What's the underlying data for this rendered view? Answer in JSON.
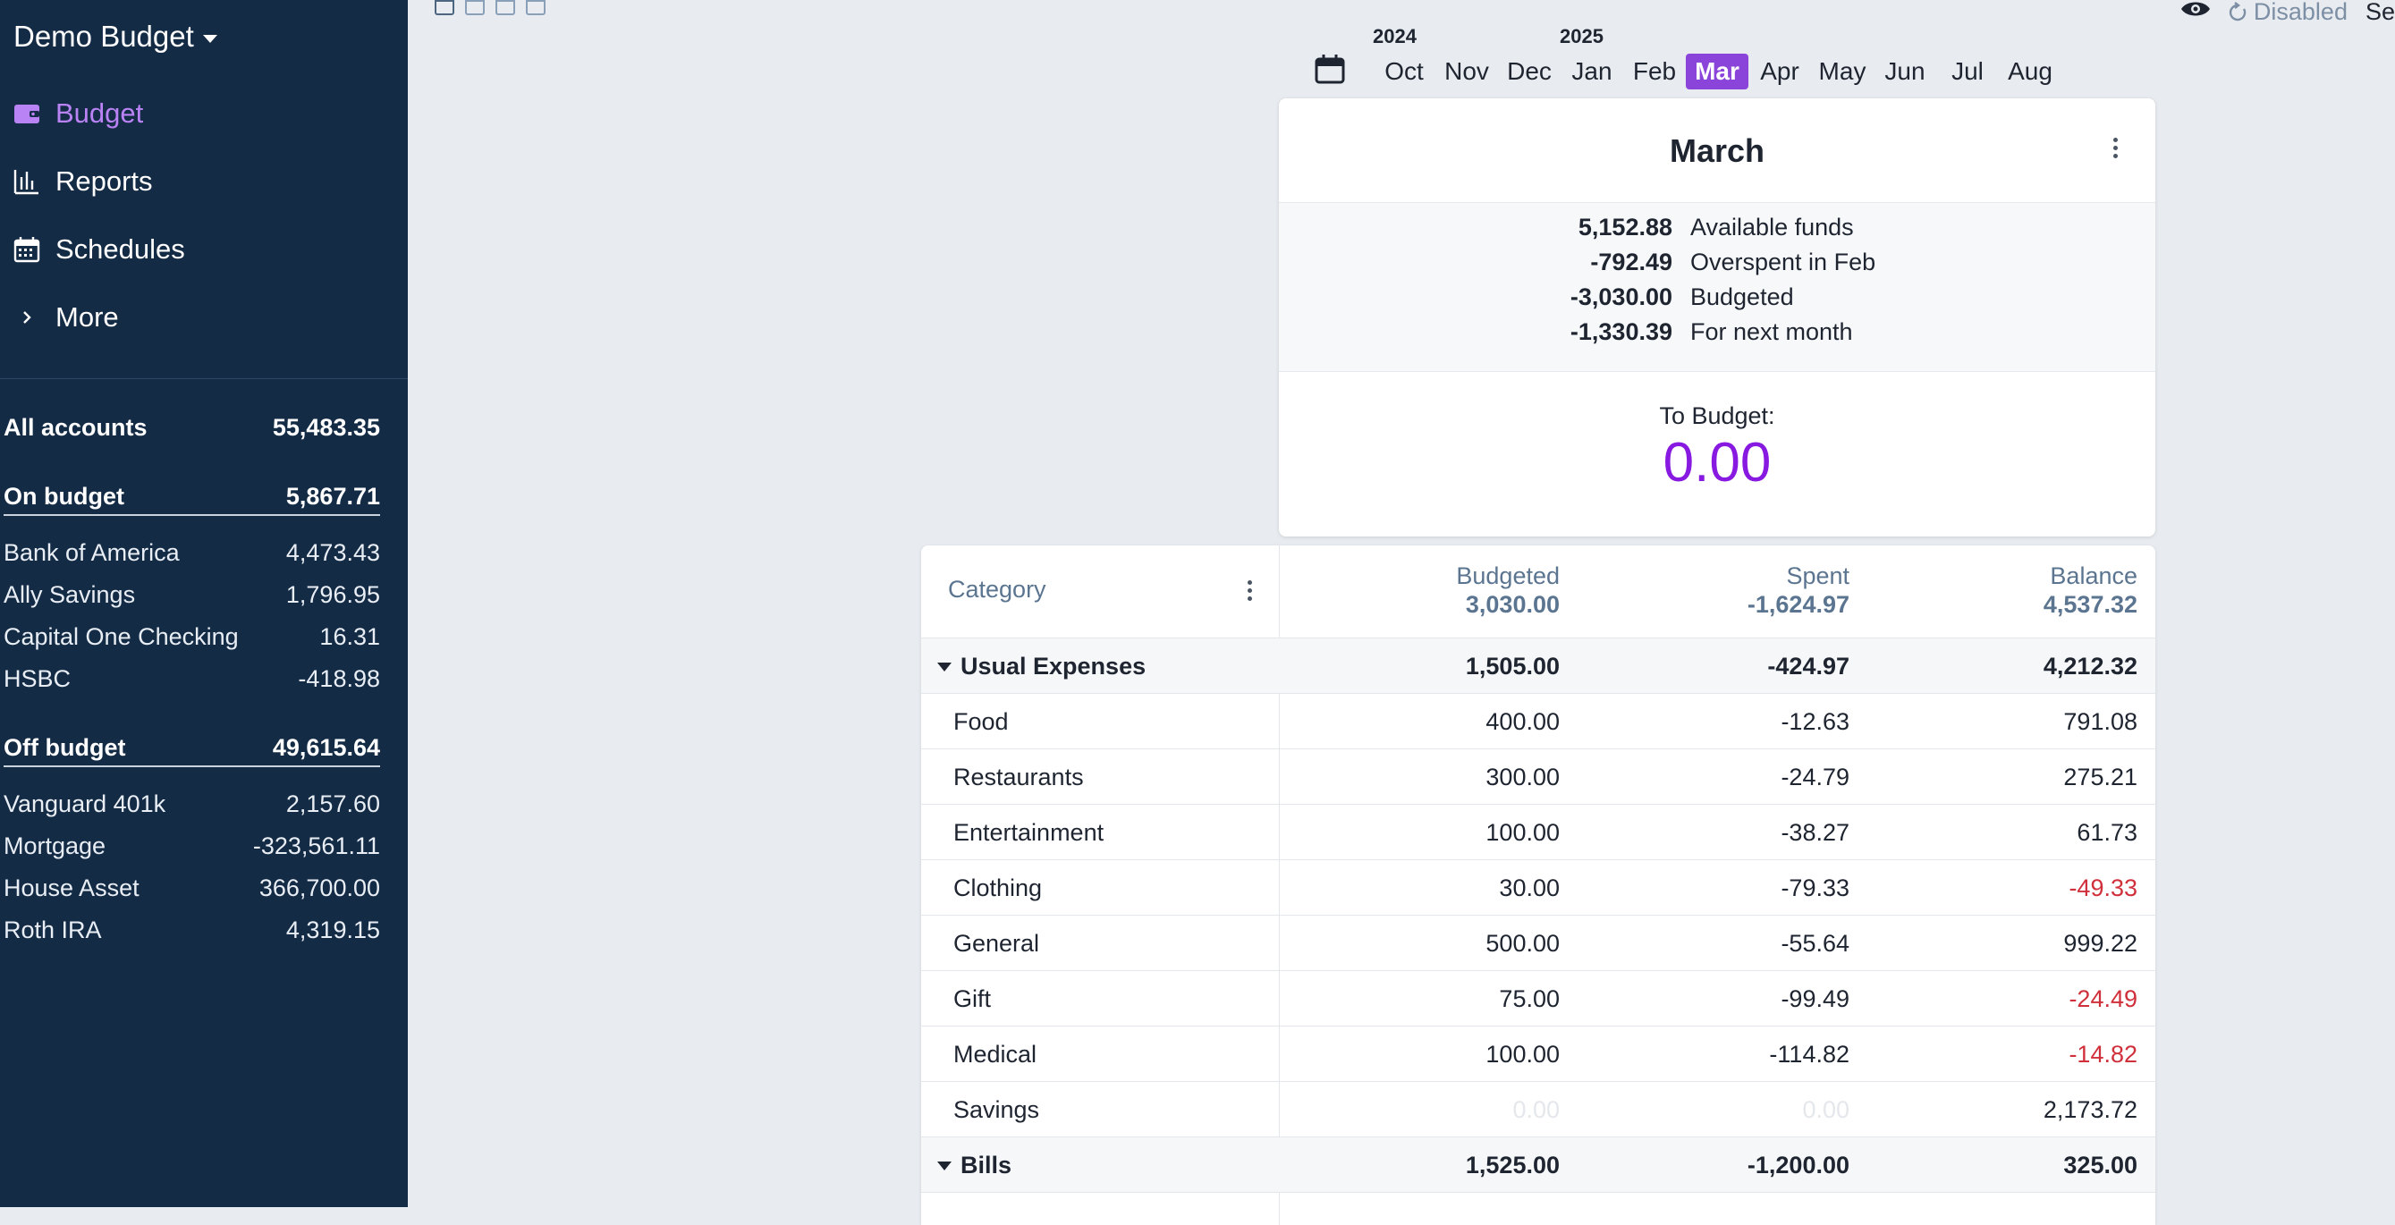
{
  "sidebar": {
    "budget_name": "Demo Budget",
    "nav": [
      {
        "label": "Budget",
        "icon": "wallet-icon",
        "active": true
      },
      {
        "label": "Reports",
        "icon": "bar-chart-icon",
        "active": false
      },
      {
        "label": "Schedules",
        "icon": "calendar-icon",
        "active": false
      },
      {
        "label": "More",
        "icon": "chevron-right-icon",
        "active": false
      }
    ],
    "all_accounts": {
      "label": "All accounts",
      "value": "55,483.35"
    },
    "on_budget": {
      "label": "On budget",
      "value": "5,867.71"
    },
    "on_budget_accounts": [
      {
        "name": "Bank of America",
        "value": "4,473.43"
      },
      {
        "name": "Ally Savings",
        "value": "1,796.95"
      },
      {
        "name": "Capital One Checking",
        "value": "16.31"
      },
      {
        "name": "HSBC",
        "value": "-418.98"
      }
    ],
    "off_budget": {
      "label": "Off budget",
      "value": "49,615.64"
    },
    "off_budget_accounts": [
      {
        "name": "Vanguard 401k",
        "value": "2,157.60"
      },
      {
        "name": "Mortgage",
        "value": "-323,561.11"
      },
      {
        "name": "House Asset",
        "value": "366,700.00"
      },
      {
        "name": "Roth IRA",
        "value": "4,319.15"
      }
    ]
  },
  "topbar": {
    "sync_label": "Disabled",
    "cut_off_text": "Se"
  },
  "month_picker": {
    "year_left": "2024",
    "year_right": "2025",
    "months": [
      "Oct",
      "Nov",
      "Dec",
      "Jan",
      "Feb",
      "Mar",
      "Apr",
      "May",
      "Jun",
      "Jul",
      "Aug"
    ],
    "selected": "Mar"
  },
  "summary": {
    "title": "March",
    "lines": [
      {
        "value": "5,152.88",
        "label": "Available funds"
      },
      {
        "value": "-792.49",
        "label": "Overspent in Feb"
      },
      {
        "value": "-3,030.00",
        "label": "Budgeted"
      },
      {
        "value": "-1,330.39",
        "label": "For next month"
      }
    ],
    "to_budget_label": "To Budget:",
    "to_budget_value": "0.00"
  },
  "table": {
    "header": {
      "category": "Category",
      "budgeted_label": "Budgeted",
      "budgeted_total": "3,030.00",
      "spent_label": "Spent",
      "spent_total": "-1,624.97",
      "balance_label": "Balance",
      "balance_total": "4,537.32"
    },
    "rows": [
      {
        "type": "group",
        "name": "Usual Expenses",
        "budgeted": "1,505.00",
        "spent": "-424.97",
        "balance": "4,212.32"
      },
      {
        "type": "cat",
        "name": "Food",
        "budgeted": "400.00",
        "spent": "-12.63",
        "balance": "791.08"
      },
      {
        "type": "cat",
        "name": "Restaurants",
        "budgeted": "300.00",
        "spent": "-24.79",
        "balance": "275.21"
      },
      {
        "type": "cat",
        "name": "Entertainment",
        "budgeted": "100.00",
        "spent": "-38.27",
        "balance": "61.73"
      },
      {
        "type": "cat",
        "name": "Clothing",
        "budgeted": "30.00",
        "spent": "-79.33",
        "balance": "-49.33"
      },
      {
        "type": "cat",
        "name": "General",
        "budgeted": "500.00",
        "spent": "-55.64",
        "balance": "999.22"
      },
      {
        "type": "cat",
        "name": "Gift",
        "budgeted": "75.00",
        "spent": "-99.49",
        "balance": "-24.49"
      },
      {
        "type": "cat",
        "name": "Medical",
        "budgeted": "100.00",
        "spent": "-114.82",
        "balance": "-14.82"
      },
      {
        "type": "cat",
        "name": "Savings",
        "budgeted": "0.00",
        "spent": "0.00",
        "balance": "2,173.72"
      },
      {
        "type": "group",
        "name": "Bills",
        "budgeted": "1,525.00",
        "spent": "-1,200.00",
        "balance": "325.00"
      }
    ]
  },
  "colors": {
    "sidebar_bg": "#142b45",
    "accent_purple": "#8b44d9",
    "to_budget_purple": "#8719e0",
    "negative_red": "#d0303b"
  }
}
